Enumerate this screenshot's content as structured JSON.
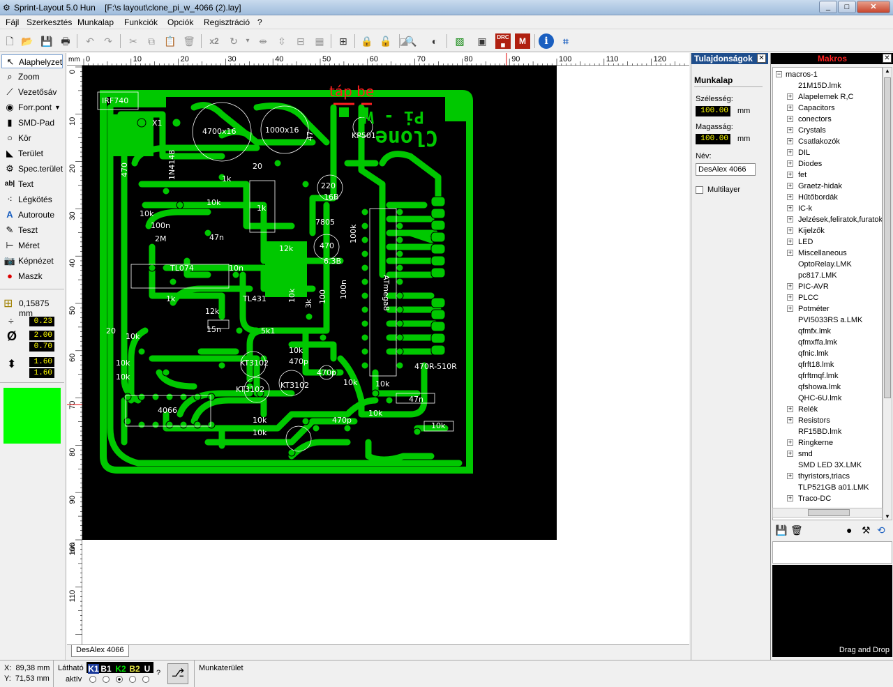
{
  "window": {
    "app_title": "Sprint-Layout 5.0 Hun",
    "file_title": "[F:\\s layout\\clone_pi_w_4066 (2).lay]",
    "min_label": "_",
    "max_label": "□",
    "close_label": "✕"
  },
  "menu": [
    "Fájl",
    "Szerkesztés",
    "Munkalap",
    "Funkciók",
    "Opciók",
    "Regisztráció",
    "?"
  ],
  "toolbar": {
    "x2_label": "x2"
  },
  "tools": [
    {
      "label": "Alaphelyzet",
      "icon": "arrow-icon"
    },
    {
      "label": "Zoom",
      "icon": "zoom-icon"
    },
    {
      "label": "Vezetősáv",
      "icon": "track-icon"
    },
    {
      "label": "Forr.pont",
      "icon": "pad-icon"
    },
    {
      "label": "SMD-Pad",
      "icon": "smd-icon"
    },
    {
      "label": "Kör",
      "icon": "circle-icon"
    },
    {
      "label": "Terület",
      "icon": "area-icon"
    },
    {
      "label": "Spec.terület",
      "icon": "special-area-icon"
    },
    {
      "label": "Text",
      "icon": "text-icon"
    },
    {
      "label": "Légkötés",
      "icon": "airwire-icon"
    },
    {
      "label": "Autoroute",
      "icon": "autoroute-icon"
    },
    {
      "label": "Teszt",
      "icon": "test-icon"
    },
    {
      "label": "Méret",
      "icon": "measure-icon"
    },
    {
      "label": "Képnézet",
      "icon": "camera-icon"
    },
    {
      "label": "Maszk",
      "icon": "mask-icon"
    }
  ],
  "grid": {
    "value": "0,15875 mm"
  },
  "params": {
    "track_width": "0.23",
    "pad_outer": "2.00",
    "pad_inner": "0.70",
    "smd_w": "1.60",
    "smd_h": "1.60"
  },
  "active_color": "#00ff00",
  "ruler": {
    "unit": "mm",
    "h_ticks": [
      "0",
      "10",
      "20",
      "30",
      "40",
      "50",
      "60",
      "70",
      "80",
      "90",
      "100",
      "110",
      "120"
    ],
    "v_ticks": [
      "0",
      "10",
      "20",
      "30",
      "40",
      "50",
      "60",
      "70",
      "80",
      "90",
      "100",
      "110"
    ]
  },
  "board": {
    "annotation": "táp be",
    "title1": "Clone",
    "title2": "Pi - W",
    "labels": [
      "IRF740",
      "X1",
      "4700x16",
      "1000x16",
      "47",
      "KP501",
      "220",
      "16B",
      "7805",
      "470",
      "6.3B",
      "100k",
      "100n",
      "ATmega8",
      "12k",
      "1k",
      "1k",
      "10k",
      "10k",
      "100n",
      "2M",
      "47n",
      "TL074",
      "10n",
      "20",
      "20",
      "470",
      "1N4148",
      "1k",
      "12k",
      "15n",
      "5k1",
      "10k",
      "10k",
      "10k",
      "KT3102",
      "KT3102",
      "KT3102",
      "10k",
      "470p",
      "470p",
      "470p",
      "10k",
      "47n",
      "10k",
      "4066",
      "10k",
      "10k",
      "10k",
      "470R-510R",
      "TL431",
      "10k",
      "3k",
      "100",
      "10k"
    ]
  },
  "sheet_tab": "DesAlex 4066",
  "properties": {
    "header": "Tulajdonságok",
    "section": "Munkalap",
    "width_label": "Szélesség:",
    "width_value": "100.00",
    "height_label": "Magasság:",
    "height_value": "100.00",
    "unit": "mm",
    "name_label": "Név:",
    "name_value": "DesAlex 4066",
    "multilayer_label": "Multilayer"
  },
  "macros": {
    "header": "Makros",
    "root": "macros-1",
    "items": [
      {
        "label": "21M15D.lmk",
        "expandable": false
      },
      {
        "label": "Alapelemek R,C",
        "expandable": true
      },
      {
        "label": "Capacitors",
        "expandable": true
      },
      {
        "label": "conectors",
        "expandable": true
      },
      {
        "label": "Crystals",
        "expandable": true
      },
      {
        "label": "Csatlakozók",
        "expandable": true
      },
      {
        "label": "DIL",
        "expandable": true
      },
      {
        "label": "Diodes",
        "expandable": true
      },
      {
        "label": "fet",
        "expandable": true
      },
      {
        "label": "Graetz-hidak",
        "expandable": true
      },
      {
        "label": "Hűtőbordák",
        "expandable": true
      },
      {
        "label": "IC-k",
        "expandable": true
      },
      {
        "label": "Jelzések,feliratok,furatok",
        "expandable": true
      },
      {
        "label": "Kijelzők",
        "expandable": true
      },
      {
        "label": "LED",
        "expandable": true
      },
      {
        "label": "Miscellaneous",
        "expandable": true
      },
      {
        "label": "OptoRelay.LMK",
        "expandable": false
      },
      {
        "label": "pc817.LMK",
        "expandable": false
      },
      {
        "label": "PIC-AVR",
        "expandable": true
      },
      {
        "label": "PLCC",
        "expandable": true
      },
      {
        "label": "Potméter",
        "expandable": true
      },
      {
        "label": "PVI5033RS a.LMK",
        "expandable": false
      },
      {
        "label": "qfmfx.lmk",
        "expandable": false
      },
      {
        "label": "qfmxffa.lmk",
        "expandable": false
      },
      {
        "label": "qfnic.lmk",
        "expandable": false
      },
      {
        "label": "qfrft18.lmk",
        "expandable": false
      },
      {
        "label": "qfrftmqf.lmk",
        "expandable": false
      },
      {
        "label": "qfshowa.lmk",
        "expandable": false
      },
      {
        "label": "QHC-6U.lmk",
        "expandable": false
      },
      {
        "label": "Relék",
        "expandable": true
      },
      {
        "label": "Resistors",
        "expandable": true
      },
      {
        "label": "RF15BD.lmk",
        "expandable": false
      },
      {
        "label": "Ringkerne",
        "expandable": true
      },
      {
        "label": "smd",
        "expandable": true
      },
      {
        "label": "SMD LED 3X.LMK",
        "expandable": false
      },
      {
        "label": "thyristors,triacs",
        "expandable": true
      },
      {
        "label": "TLP521GB a01.LMK",
        "expandable": false
      },
      {
        "label": "Traco-DC",
        "expandable": true
      }
    ],
    "drag_hint": "Drag and Drop"
  },
  "status": {
    "x_label": "X:",
    "x_value": "89,38 mm",
    "y_label": "Y:",
    "y_value": "71,53 mm",
    "visible_label": "Látható",
    "active_label": "aktív",
    "layers": [
      "K1",
      "B1",
      "K2",
      "B2",
      "U"
    ],
    "help": "?",
    "workspace": "Munkaterület"
  }
}
